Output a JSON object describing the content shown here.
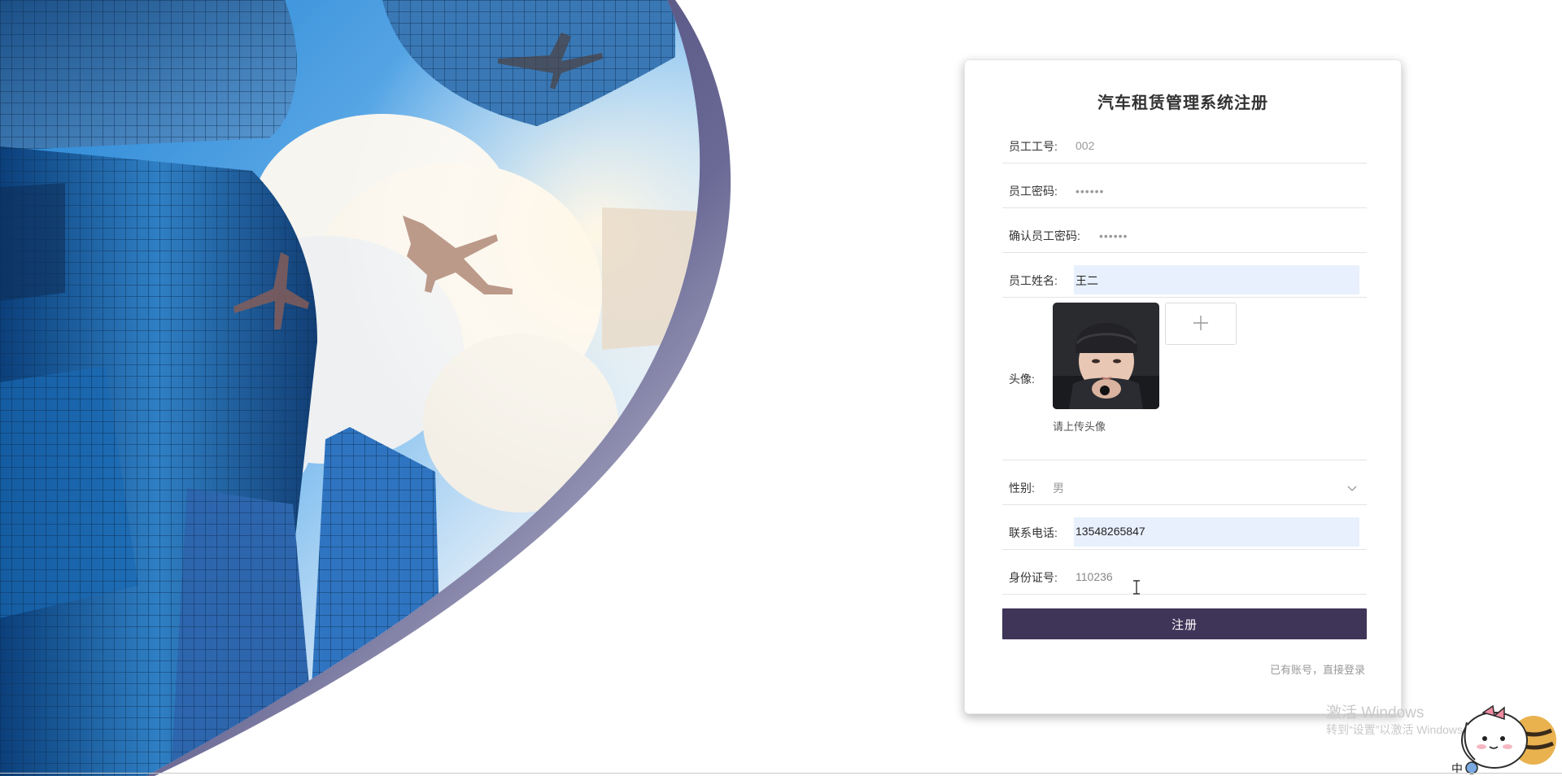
{
  "form": {
    "title": "汽车租赁管理系统注册",
    "fields": [
      {
        "label": "员工工号:",
        "value": "002"
      },
      {
        "label": "员工密码:",
        "value": "••••••"
      },
      {
        "label": "确认员工密码:",
        "value": "••••••"
      },
      {
        "label": "员工姓名:",
        "value": "王二"
      },
      {
        "label": "头像:",
        "upload_icon": "plus-icon",
        "hint": "请上传头像"
      },
      {
        "label": "性别:",
        "value": "男",
        "icon": "chevron-down-icon"
      },
      {
        "label": "联系电话:",
        "value": "13548265847"
      },
      {
        "label": "身份证号:",
        "value": "110236"
      }
    ],
    "submit_label": "注册",
    "login_link": "已有账号，直接登录"
  },
  "watermark": {
    "line1": "激活 Windows",
    "line2": "转到“设置”以激活 Windows。"
  },
  "taskbar": {
    "ime": "中"
  },
  "colors": {
    "primary": "#3f3558",
    "autofill": "#e8f0fe",
    "hero_frame": "#3b3569"
  }
}
